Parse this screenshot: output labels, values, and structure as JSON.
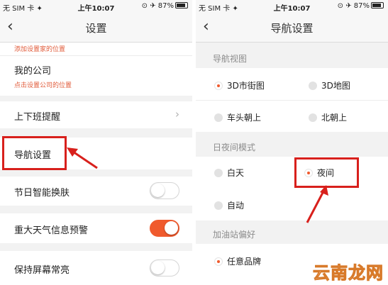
{
  "left": {
    "status": {
      "carrier": "无 SIM 卡 ✦",
      "time": "上午10:07",
      "battery": "⊙ ✈ 87%"
    },
    "nav": {
      "back": "‹",
      "title": "设置"
    },
    "rows": {
      "top_hint": "添加设置家的位置",
      "company": "我的公司",
      "company_hint": "点击设置公司的位置",
      "commute": "上下班提醒",
      "navigation": "导航设置",
      "holiday_skin": "节日智能换肤",
      "weather_alert": "重大天气信息预警",
      "screen_on": "保持屏幕常亮"
    },
    "toggles": {
      "holiday_skin": false,
      "weather_alert": true,
      "screen_on": false
    }
  },
  "right": {
    "status": {
      "carrier": "无 SIM 卡 ✦",
      "time": "上午10:07",
      "battery": "⊙ ✈ 87%"
    },
    "nav": {
      "back": "‹",
      "title": "导航设置"
    },
    "sections": {
      "view": "导航视图",
      "daynight": "日夜间模式",
      "gas": "加油站偏好"
    },
    "options": {
      "street_3d": "3D市街图",
      "map_3d": "3D地图",
      "head_up": "车头朝上",
      "north_up": "北朝上",
      "day": "白天",
      "night": "夜间",
      "auto": "自动",
      "any_brand": "任意品牌"
    },
    "selected": {
      "view": "3D市街图",
      "daynight": "夜间",
      "gas": "任意品牌"
    }
  },
  "watermark": "云南龙网",
  "colors": {
    "accent": "#f05a2d",
    "highlight": "#d8201c",
    "hint": "#e15b3a"
  }
}
